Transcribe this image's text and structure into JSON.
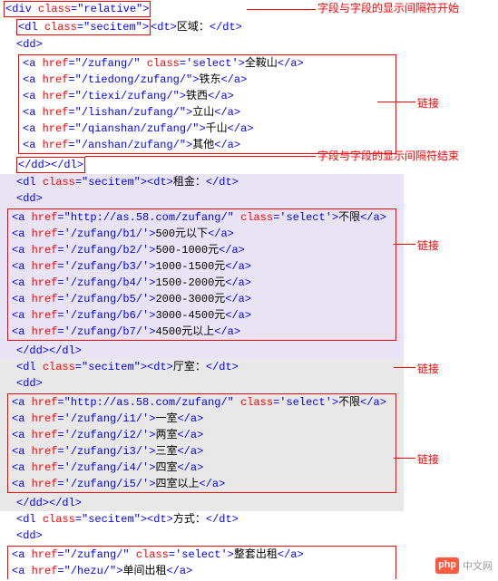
{
  "annotations": {
    "field_start": "字段与字段的显示间隔符开始",
    "field_end": "字段与字段的显示间隔符结束",
    "link": "链接"
  },
  "section_region": {
    "open_div": "<div class=\"relative\">",
    "dl_open": "<dl class=\"secitem\">",
    "dt": "<dt>区域：</dt>",
    "dd_open": "<dd>",
    "links": [
      "<a href=\"/zufang/\" class='select'>全鞍山</a>",
      "<a href=\"/tiedong/zufang/\">铁东</a>",
      "<a href=\"/tiexi/zufang/\">铁西</a>",
      "<a href=\"/lishan/zufang/\">立山</a>",
      "<a href=\"/qianshan/zufang/\">千山</a>",
      "<a href=\"/anshan/zufang/\">其他</a>"
    ],
    "close": "</dd></dl>"
  },
  "section_rent": {
    "dl_open": "<dl class=\"secitem\"><dt>租金：</dt>",
    "dd_open": "<dd>",
    "links": [
      "<a href=\"http://as.58.com/zufang/\" class='select'>不限</a>",
      "<a href='/zufang/b1/'>500元以下</a>",
      "<a href='/zufang/b2/'>500-1000元</a>",
      "<a href='/zufang/b3/'>1000-1500元</a>",
      "<a href='/zufang/b4/'>1500-2000元</a>",
      "<a href='/zufang/b5/'>2000-3000元</a>",
      "<a href='/zufang/b6/'>3000-4500元</a>",
      "<a href='/zufang/b7/'>4500元以上</a>"
    ],
    "close": "</dd></dl>"
  },
  "section_room": {
    "dl_open": "<dl class=\"secitem\"><dt>厅室：</dt>",
    "dd_open": "<dd>",
    "links": [
      "<a href=\"http://as.58.com/zufang/\" class='select'>不限</a>",
      "<a href='/zufang/i1/'>一室</a>",
      "<a href='/zufang/i2/'>两室</a>",
      "<a href='/zufang/i3/'>三室</a>",
      "<a href='/zufang/i4/'>四室</a>",
      "<a href='/zufang/i5/'>四室以上</a>"
    ],
    "close": "</dd></dl>"
  },
  "section_mode": {
    "dl_open": "<dl class=\"secitem\"><dt>方式：</dt>",
    "dd_open": "<dd>",
    "links": [
      "<a href=\"/zufang/\" class='select'>整套出租</a>",
      "<a href=\"/hezu/\">单间出租</a>"
    ]
  },
  "watermark": {
    "logo": "php",
    "text": "中文网"
  }
}
